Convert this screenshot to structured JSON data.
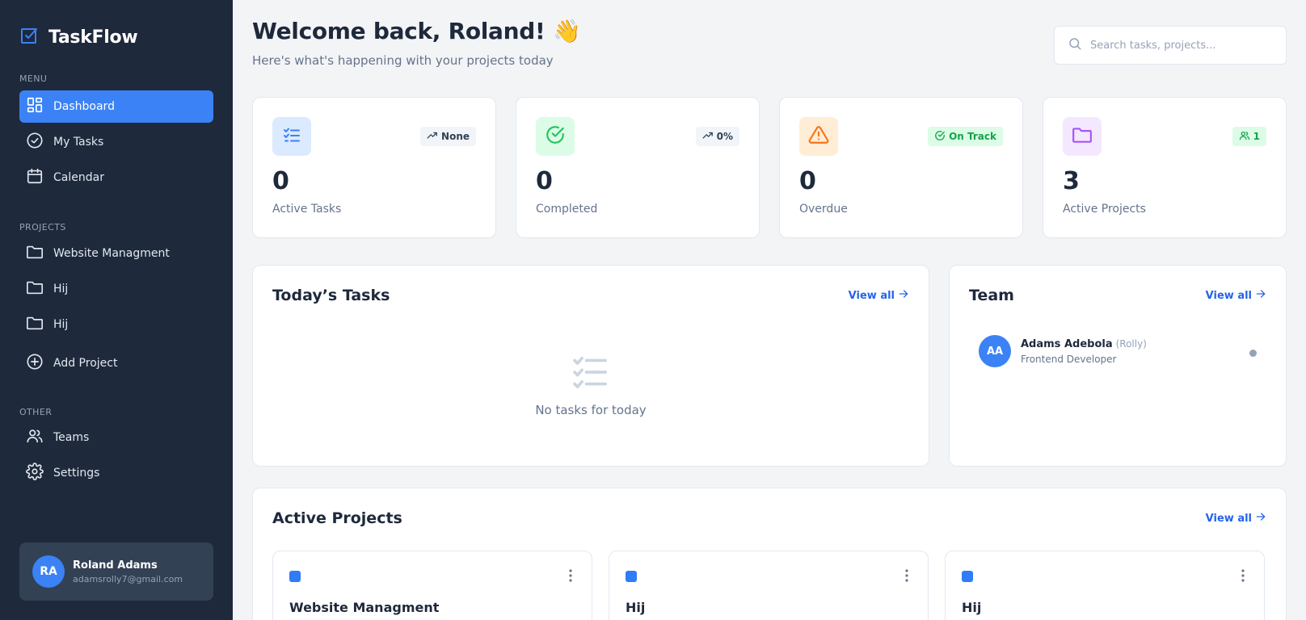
{
  "app": {
    "name": "TaskFlow"
  },
  "sidebar": {
    "menu_label": "MENU",
    "menu_items": [
      {
        "label": "Dashboard",
        "icon": "dashboard-grid-icon",
        "active": true
      },
      {
        "label": "My Tasks",
        "icon": "check-circle-icon",
        "active": false
      },
      {
        "label": "Calendar",
        "icon": "calendar-icon",
        "active": false
      }
    ],
    "projects_label": "PROJECTS",
    "projects": [
      {
        "label": "Website Managment",
        "icon": "folder-icon"
      },
      {
        "label": "Hij",
        "icon": "folder-icon"
      },
      {
        "label": "Hij",
        "icon": "folder-icon"
      }
    ],
    "add_project_label": "Add Project",
    "other_label": "OTHER",
    "other_items": [
      {
        "label": "Teams",
        "icon": "users-icon"
      },
      {
        "label": "Settings",
        "icon": "gear-icon"
      }
    ],
    "user": {
      "initials": "RA",
      "name": "Roland Adams",
      "email": "adamsrolly7@gmail.com"
    }
  },
  "header": {
    "welcome": "Welcome back, Roland! 👋",
    "subtitle": "Here's what's happening with your projects today",
    "search_placeholder": "Search tasks, projects..."
  },
  "stats": [
    {
      "value": "0",
      "label": "Active Tasks",
      "badge": "None",
      "icon": "list-check-icon",
      "badge_icon": "trend-up-icon",
      "icon_bg": "#dbeafe",
      "icon_color": "#3b82f6",
      "badge_bg": "#f1f5f9",
      "badge_color": "#334155"
    },
    {
      "value": "0",
      "label": "Completed",
      "badge": "0%",
      "icon": "check-circle-icon",
      "badge_icon": "trend-up-icon",
      "icon_bg": "#dcfce7",
      "icon_color": "#22c55e",
      "badge_bg": "#f1f5f9",
      "badge_color": "#334155"
    },
    {
      "value": "0",
      "label": "Overdue",
      "badge": "On Track",
      "icon": "alert-triangle-icon",
      "badge_icon": "check-circle-icon",
      "icon_bg": "#ffedd5",
      "icon_color": "#f97316",
      "badge_bg": "#dcfce7",
      "badge_color": "#16a34a"
    },
    {
      "value": "3",
      "label": "Active Projects",
      "badge": "1",
      "icon": "folder-icon",
      "badge_icon": "users-icon",
      "icon_bg": "#f3e8ff",
      "icon_color": "#a855f7",
      "badge_bg": "#dcfce7",
      "badge_color": "#16a34a"
    }
  ],
  "todays_tasks": {
    "title": "Today’s Tasks",
    "view_all": "View all",
    "empty_text": "No tasks for today"
  },
  "team": {
    "title": "Team",
    "view_all": "View all",
    "members": [
      {
        "initials": "AA",
        "name": "Adams Adebola",
        "nickname": "(Rolly)",
        "role": "Frontend Developer"
      }
    ]
  },
  "active_projects": {
    "title": "Active Projects",
    "view_all": "View all",
    "projects": [
      {
        "name": "Website Managment",
        "color": "#2f7cf6"
      },
      {
        "name": "Hij",
        "color": "#2f7cf6"
      },
      {
        "name": "Hij",
        "color": "#2f7cf6"
      }
    ]
  }
}
